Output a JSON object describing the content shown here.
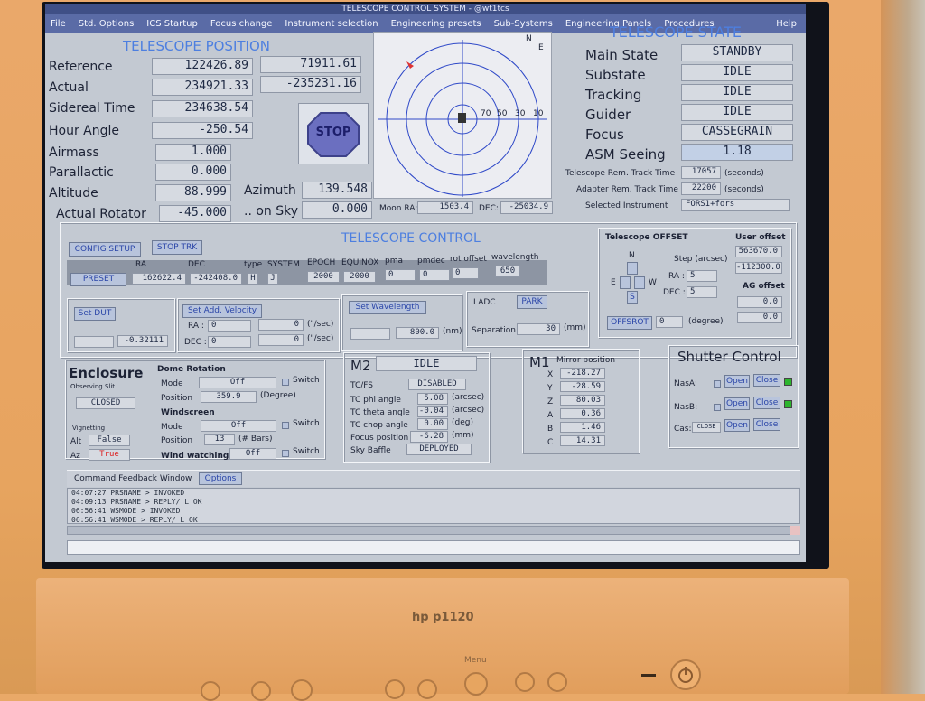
{
  "window": {
    "title": "TELESCOPE CONTROL SYSTEM - @wt1tcs"
  },
  "menu": [
    "File",
    "Std. Options",
    "ICS Startup",
    "Focus change",
    "Instrument selection",
    "Engineering presets",
    "Sub-Systems",
    "Engineering Panels",
    "Procedures"
  ],
  "menu_help": "Help",
  "position": {
    "title": "TELESCOPE POSITION",
    "reference_label": "Reference",
    "reference_ra": "122426.89",
    "reference_dec": "71911.61",
    "actual_label": "Actual",
    "actual_ra": "234921.33",
    "actual_dec": "-235231.16",
    "sidereal_label": "Sidereal Time",
    "sidereal": "234638.54",
    "hour_angle_label": "Hour Angle",
    "hour_angle": "-250.54",
    "airmass_label": "Airmass",
    "airmass": "1.000",
    "parallactic_label": "Parallactic",
    "parallactic": "0.000",
    "altitude_label": "Altitude",
    "altitude": "88.999",
    "azimuth_label": "Azimuth",
    "azimuth": "139.548",
    "rotator_label": "Actual Rotator",
    "rotator": "-45.000",
    "on_sky_label": ".. on Sky",
    "on_sky": "0.000",
    "stop_label": "STOP"
  },
  "skyplot": {
    "n": "N",
    "e": "E",
    "ring_labels": [
      "70",
      "50",
      "30",
      "10"
    ],
    "moon_ra_label": "Moon RA:",
    "moon_ra": "1503.4",
    "moon_dec_label": "DEC:",
    "moon_dec": "-25034.9"
  },
  "state": {
    "title": "TELESCOPE STATE",
    "main_label": "Main State",
    "main": "STANDBY",
    "sub_label": "Substate",
    "sub": "IDLE",
    "tracking_label": "Tracking",
    "tracking": "IDLE",
    "guider_label": "Guider",
    "guider": "IDLE",
    "focus_label": "Focus",
    "focus": "CASSEGRAIN",
    "seeing_label": "ASM Seeing",
    "seeing": "1.18",
    "tel_track_label": "Telescope Rem. Track Time",
    "tel_track": "17057",
    "tel_track_unit": "(seconds)",
    "adp_track_label": "Adapter Rem. Track Time",
    "adp_track": "22200",
    "adp_track_unit": "(seconds)",
    "instrument_label": "Selected Instrument",
    "instrument": "FORS1+fors"
  },
  "control": {
    "title": "TELESCOPE CONTROL",
    "config_setup": "CONFIG SETUP",
    "stop_trk": "STOP TRK",
    "preset": "PRESET",
    "col_ra": "RA",
    "col_dec": "DEC",
    "col_type": "type",
    "col_system": "SYSTEM",
    "col_epoch": "EPOCH",
    "col_equinox": "EQUINOX",
    "col_pma": "pma",
    "col_pmdec": "pmdec",
    "col_rot": "rot offset",
    "col_wave": "wavelength",
    "ra": "162622.4",
    "dec": "-242408.0",
    "type": "H",
    "system": "J",
    "epoch": "2000",
    "equinox": "2000",
    "pma": "0",
    "pmdec": "0",
    "rot": "0",
    "wave": "650",
    "set_dut": "Set DUT",
    "dut": "-0.32111",
    "set_add_velocity": "Set Add. Velocity",
    "vra_label": "RA :",
    "vra_a": "0",
    "vra_b": "0",
    "vra_unit": "(\"/sec)",
    "vdec_label": "DEC :",
    "vdec_a": "0",
    "vdec_b": "0",
    "vdec_unit": "(\"/sec)",
    "set_wavelength": "Set Wavelength",
    "wavelength": "800.0",
    "wavelength_unit": "(nm)",
    "ladc_label": "LADC",
    "park": "PARK",
    "separation_label": "Separation",
    "separation": "30",
    "separation_unit": "(mm)"
  },
  "offset": {
    "title": "Telescope OFFSET",
    "step_label": "Step (arcsec)",
    "ra_label": "RA :",
    "ra_step": "5",
    "dec_label": "DEC :",
    "dec_step": "5",
    "n": "N",
    "s": "S",
    "e": "E",
    "w": "W",
    "offsrot": "OFFSROT",
    "offsrot_val": "0",
    "offsrot_unit": "(degree)",
    "user_offset_label": "User offset",
    "user_offset_a": "563670.0",
    "user_offset_b": "-112300.0",
    "ag_offset_label": "AG offset",
    "ag_offset_a": "0.0",
    "ag_offset_b": "0.0"
  },
  "enclosure": {
    "title": "Enclosure",
    "slit_label": "Observing Slit",
    "slit": "CLOSED",
    "dome_label": "Dome Rotation",
    "dome_mode_label": "Mode",
    "dome_mode": "Off",
    "dome_switch": "Switch",
    "dome_pos_label": "Position",
    "dome_pos": "359.9",
    "dome_pos_unit": "(Degree)",
    "vign_label": "Vignetting",
    "alt_label": "Alt",
    "alt_val": "False",
    "az_label": "Az",
    "az_val": "True",
    "wind_label": "Windscreen",
    "wind_mode_label": "Mode",
    "wind_mode": "Off",
    "wind_switch": "Switch",
    "wind_pos_label": "Position",
    "wind_pos": "13",
    "wind_pos_unit": "(# Bars)",
    "watch_label": "Wind watching",
    "watch": "Off",
    "watch_switch": "Switch"
  },
  "m2": {
    "title": "M2",
    "state": "IDLE",
    "tcfs_label": "TC/FS",
    "tcfs": "DISABLED",
    "phi_label": "TC phi angle",
    "phi": "5.08",
    "phi_unit": "(arcsec)",
    "theta_label": "TC theta angle",
    "theta": "-0.04",
    "theta_unit": "(arcsec)",
    "chop_label": "TC chop angle",
    "chop": "0.00",
    "chop_unit": "(deg)",
    "focus_label": "Focus position",
    "focus": "-6.28",
    "focus_unit": "(mm)",
    "baffle_label": "Sky Baffle",
    "baffle": "DEPLOYED"
  },
  "m1": {
    "title": "M1",
    "subtitle": "Mirror position",
    "x_label": "X",
    "x": "-218.27",
    "y_label": "Y",
    "y": "-28.59",
    "z_label": "Z",
    "z": "80.03",
    "a_label": "A",
    "a": "0.36",
    "b_label": "B",
    "b": "1.46",
    "c_label": "C",
    "c": "14.31"
  },
  "shutter": {
    "title": "Shutter Control",
    "nasa_label": "NasA:",
    "nasb_label": "NasB:",
    "cas_label": "Cas:",
    "cas_state": "CLOSE",
    "open": "Open",
    "close": "Close"
  },
  "feedback": {
    "title": "Command Feedback Window",
    "options": "Options",
    "lines": [
      "04:07:27 PRSNAME > INVOKED",
      "04:09:13 PRSNAME > REPLY/ L    OK",
      "06:56:41 WSMODE  > INVOKED",
      "06:56:41 WSMODE  > REPLY/ L    OK"
    ]
  },
  "monitor": {
    "brand": "hp p1120",
    "menu_label": "Menu"
  }
}
